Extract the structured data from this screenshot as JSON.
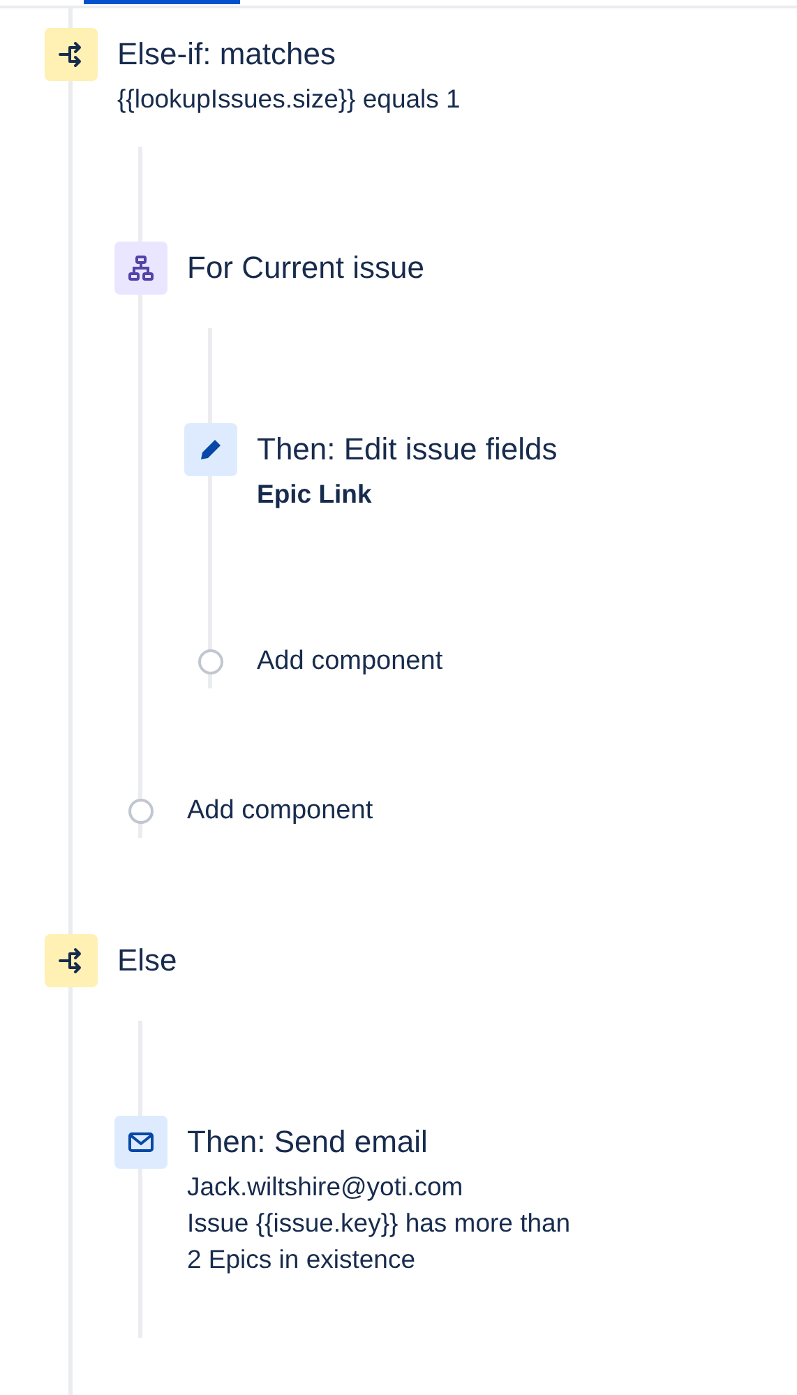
{
  "components": [
    {
      "kind": "condition",
      "title": "Else-if: matches",
      "details": [
        {
          "text": "{{lookupIssues.size}} equals 1",
          "bold": false
        }
      ],
      "children": [
        {
          "kind": "branch",
          "title": "For Current issue",
          "children": [
            {
              "kind": "edit",
              "title": "Then: Edit issue fields",
              "details": [
                {
                  "text": "Epic Link",
                  "bold": true
                }
              ]
            },
            {
              "kind": "add",
              "title": "Add component"
            }
          ]
        },
        {
          "kind": "add",
          "title": "Add component"
        }
      ]
    },
    {
      "kind": "condition",
      "title": "Else",
      "children": [
        {
          "kind": "email",
          "title": "Then: Send email",
          "details": [
            {
              "text": "Jack.wiltshire@yoti.com",
              "bold": false
            },
            {
              "text": "Issue {{issue.key}} has more than",
              "bold": false
            },
            {
              "text": "2 Epics in existence",
              "bold": false
            }
          ]
        }
      ]
    }
  ]
}
